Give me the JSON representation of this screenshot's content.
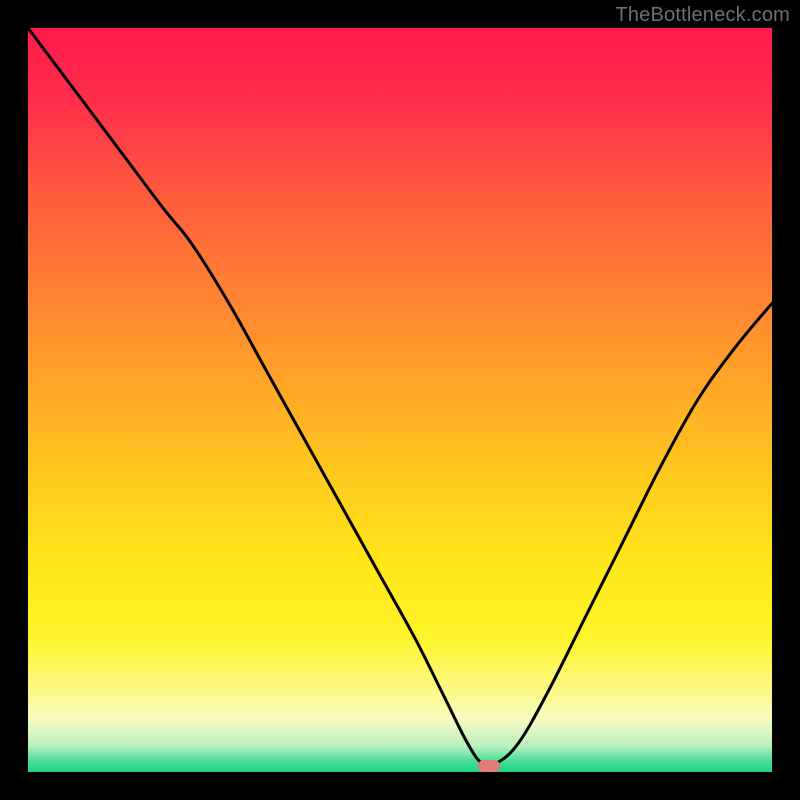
{
  "watermark": "TheBottleneck.com",
  "colors": {
    "frame": "#000000",
    "curve": "#000000",
    "marker": "#e47c79"
  },
  "gradient_stops": [
    {
      "offset": 0.0,
      "color": "#ff1a4d"
    },
    {
      "offset": 0.1,
      "color": "#ff2e4a"
    },
    {
      "offset": 0.22,
      "color": "#ff5a3e"
    },
    {
      "offset": 0.35,
      "color": "#ff8033"
    },
    {
      "offset": 0.48,
      "color": "#ffa628"
    },
    {
      "offset": 0.6,
      "color": "#ffc91f"
    },
    {
      "offset": 0.72,
      "color": "#ffe61a"
    },
    {
      "offset": 0.82,
      "color": "#fff42a"
    },
    {
      "offset": 0.88,
      "color": "#fdf97a"
    },
    {
      "offset": 0.93,
      "color": "#f7fbc0"
    },
    {
      "offset": 0.965,
      "color": "#b8f0c0"
    },
    {
      "offset": 0.985,
      "color": "#4adf98"
    },
    {
      "offset": 1.0,
      "color": "#1fd584"
    }
  ],
  "chart_data": {
    "type": "line",
    "title": "",
    "xlabel": "",
    "ylabel": "",
    "xlim": [
      0,
      100
    ],
    "ylim": [
      0,
      100
    ],
    "min_marker_x": 62,
    "x": [
      0,
      6,
      12,
      18,
      22,
      27,
      32,
      37,
      42,
      47,
      52,
      56,
      59,
      61,
      63,
      66,
      70,
      75,
      80,
      85,
      90,
      95,
      100
    ],
    "values": [
      100,
      92,
      84,
      76,
      71,
      63,
      54,
      45,
      36,
      27,
      18,
      10,
      4,
      1.2,
      1.2,
      4,
      11,
      21,
      31,
      41,
      50,
      57,
      63
    ]
  }
}
